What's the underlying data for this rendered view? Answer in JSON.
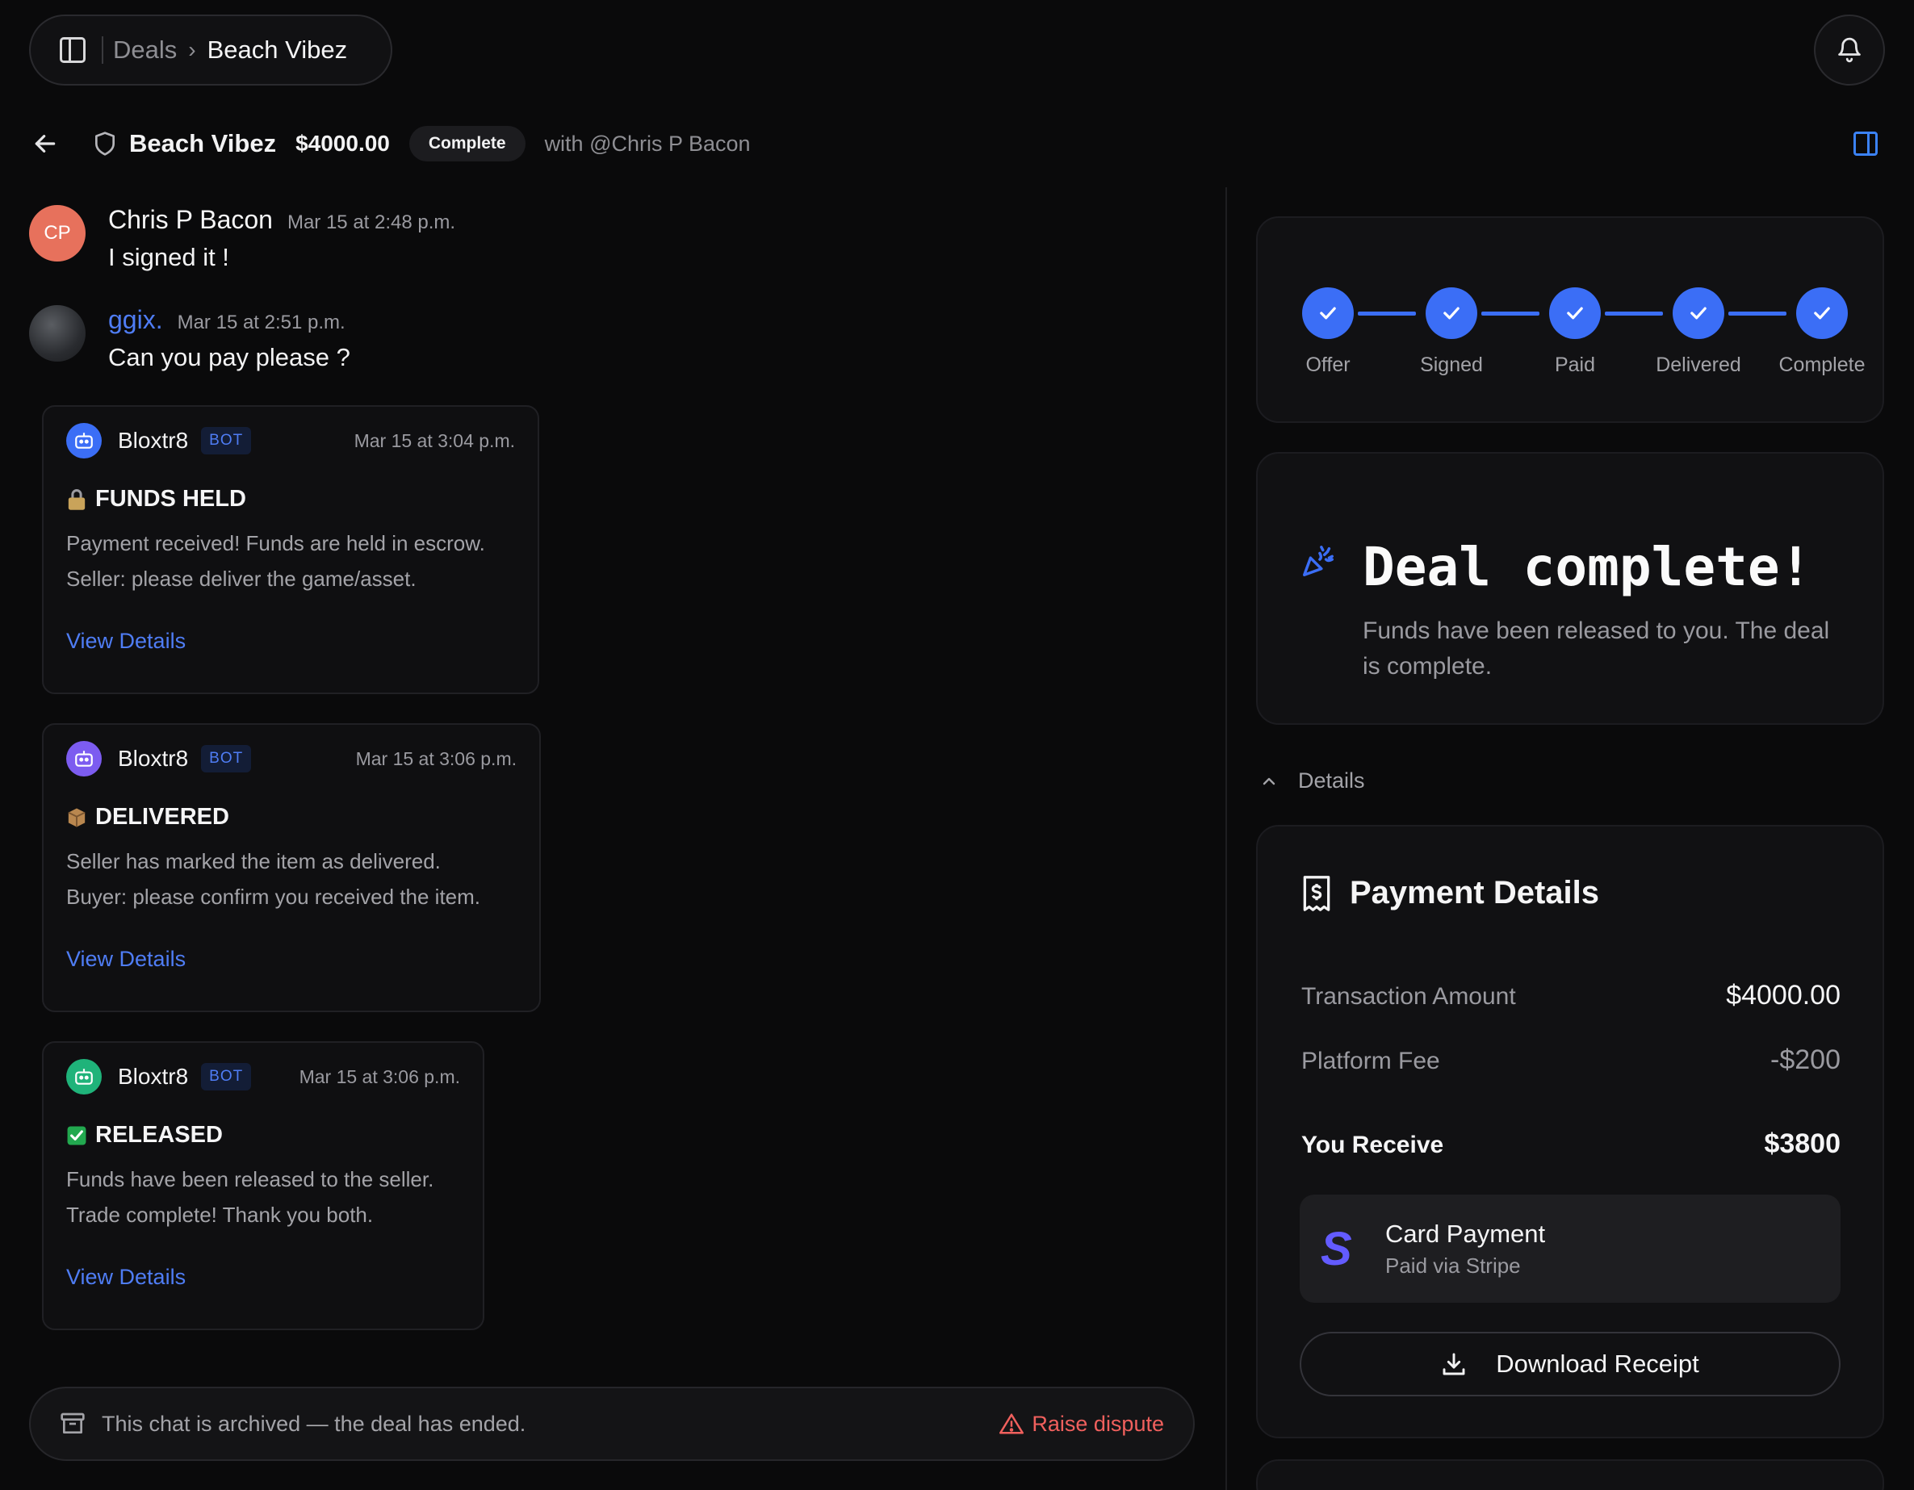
{
  "breadcrumb": {
    "root": "Deals",
    "current": "Beach Vibez"
  },
  "deal": {
    "title": "Beach Vibez",
    "amount": "$4000.00",
    "status": "Complete",
    "with_user": "with @Chris P Bacon"
  },
  "messages": [
    {
      "initials": "CP",
      "name": "Chris P Bacon",
      "time": "Mar 15 at 2:48 p.m.",
      "text": "I signed it !"
    },
    {
      "name": "ggix.",
      "time": "Mar 15 at 2:51 p.m.",
      "text": "Can you pay please ?"
    }
  ],
  "bot_cards": [
    {
      "name": "Bloxtr8",
      "tag": "BOT",
      "time": "Mar 15 at 3:04 p.m.",
      "title": "FUNDS HELD",
      "lines": [
        "Payment received! Funds are held in escrow.",
        "Seller: please deliver the game/asset."
      ],
      "link": "View Details",
      "color": "#3b6ef6",
      "icon": "lock-emoji"
    },
    {
      "name": "Bloxtr8",
      "tag": "BOT",
      "time": "Mar 15 at 3:06 p.m.",
      "title": "DELIVERED",
      "lines": [
        "Seller has marked the item as delivered.",
        "Buyer: please confirm you received the item."
      ],
      "link": "View Details",
      "color": "#7c5cf0",
      "icon": "package-emoji"
    },
    {
      "name": "Bloxtr8",
      "tag": "BOT",
      "time": "Mar 15 at 3:06 p.m.",
      "title": "RELEASED",
      "lines": [
        "Funds have been released to the seller.",
        "Trade complete! Thank you both."
      ],
      "link": "View Details",
      "color": "#1fb37a",
      "icon": "check-emoji"
    }
  ],
  "archived": {
    "text": "This chat is archived — the deal has ended.",
    "dispute_label": "Raise dispute"
  },
  "steps": [
    "Offer",
    "Signed",
    "Paid",
    "Delivered",
    "Complete"
  ],
  "complete": {
    "title": "Deal complete!",
    "subtitle": "Funds have been released to you. The deal is complete."
  },
  "details_toggle": "Details",
  "payment": {
    "title": "Payment Details",
    "rows": [
      {
        "label": "Transaction Amount",
        "value": "$4000.00"
      },
      {
        "label": "Platform Fee",
        "value": "-$200"
      },
      {
        "label": "You Receive",
        "value": "$3800"
      }
    ],
    "method_title": "Card Payment",
    "method_sub": "Paid via Stripe",
    "stripe_letter": "S",
    "download_label": "Download Receipt"
  },
  "colors": {
    "accent": "#3b6ef6",
    "danger": "#f0605d",
    "stripe": "#635bff",
    "avatar_cp": "#e7715c"
  }
}
